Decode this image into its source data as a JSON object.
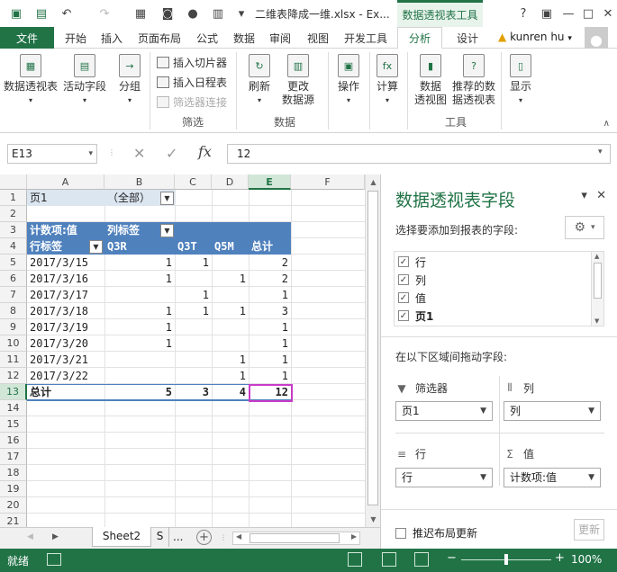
{
  "title_bar": {
    "title": "二维表降成一维.xlsx - Ex...",
    "contextual_tab": "数据透视表工具",
    "help": "?",
    "restore": "▣",
    "minimize": "—",
    "maximize": "□",
    "close": "✕"
  },
  "tabs": {
    "file": "文件",
    "items": [
      "开始",
      "插入",
      "页面布局",
      "公式",
      "数据",
      "审阅",
      "视图",
      "开发工具"
    ],
    "analyze": "分析",
    "design": "设计",
    "user": "kunren hu"
  },
  "ribbon": {
    "pivot_table": "数据透视表",
    "active_field": "活动字段",
    "group": "分组",
    "insert_slicer": "插入切片器",
    "insert_timeline": "插入日程表",
    "filter_connections": "筛选器连接",
    "group_filter": "筛选",
    "refresh": "刷新",
    "change_source_1": "更改",
    "change_source_2": "数据源",
    "group_data": "数据",
    "actions": "操作",
    "calculations": "计算",
    "pivot_chart_1": "数据",
    "pivot_chart_2": "透视图",
    "recommended_1": "推荐的数",
    "recommended_2": "据透视表",
    "group_tools": "工具",
    "show": "显示"
  },
  "formula_bar": {
    "name_box": "E13",
    "cancel": "✕",
    "confirm": "✓",
    "fx": "fx",
    "value": "12"
  },
  "grid": {
    "columns": [
      "A",
      "B",
      "C",
      "D",
      "E",
      "F"
    ],
    "rows": [
      "1",
      "2",
      "3",
      "4",
      "5",
      "6",
      "7",
      "8",
      "9",
      "10",
      "11",
      "12",
      "13",
      "14",
      "15",
      "16",
      "17",
      "18",
      "19",
      "20",
      "21"
    ],
    "page_filter_label": "页1",
    "page_filter_value": "（全部）",
    "count_label": "计数项:值",
    "col_labels": "列标签",
    "row_labels": "行标签",
    "col_headers": [
      "Q3R",
      "Q3T",
      "Q5M",
      "总计"
    ],
    "data_rows": [
      {
        "label": "2017/3/15",
        "b": "1",
        "c": "1",
        "d": "",
        "e": "2"
      },
      {
        "label": "2017/3/16",
        "b": "1",
        "c": "",
        "d": "1",
        "e": "2"
      },
      {
        "label": "2017/3/17",
        "b": "",
        "c": "1",
        "d": "",
        "e": "1"
      },
      {
        "label": "2017/3/18",
        "b": "1",
        "c": "1",
        "d": "1",
        "e": "3"
      },
      {
        "label": "2017/3/19",
        "b": "1",
        "c": "",
        "d": "",
        "e": "1"
      },
      {
        "label": "2017/3/20",
        "b": "1",
        "c": "",
        "d": "",
        "e": "1"
      },
      {
        "label": "2017/3/21",
        "b": "",
        "c": "",
        "d": "1",
        "e": "1"
      },
      {
        "label": "2017/3/22",
        "b": "",
        "c": "",
        "d": "1",
        "e": "1"
      }
    ],
    "total_label": "总计",
    "totals": {
      "b": "5",
      "c": "3",
      "d": "4",
      "e": "12"
    }
  },
  "sheet_tabs": {
    "sheet2": "Sheet2",
    "partial": "S",
    "more": "...",
    "add": "+"
  },
  "pane": {
    "title": "数据透视表字段",
    "dropdown": "▾",
    "close": "✕",
    "subtitle": "选择要添加到报表的字段:",
    "fields": [
      "行",
      "列",
      "值",
      "页1"
    ],
    "drag_hint": "在以下区域间拖动字段:",
    "filters_title": "筛选器",
    "filters_value": "页1",
    "columns_title": "列",
    "columns_value": "列",
    "rows_title": "行",
    "rows_value": "行",
    "values_title": "值",
    "values_value": "计数项:值",
    "defer": "推迟布局更新",
    "update": "更新"
  },
  "status": {
    "ready": "就绪",
    "zoom_minus": "−",
    "zoom_plus": "+",
    "zoom": "100%"
  }
}
